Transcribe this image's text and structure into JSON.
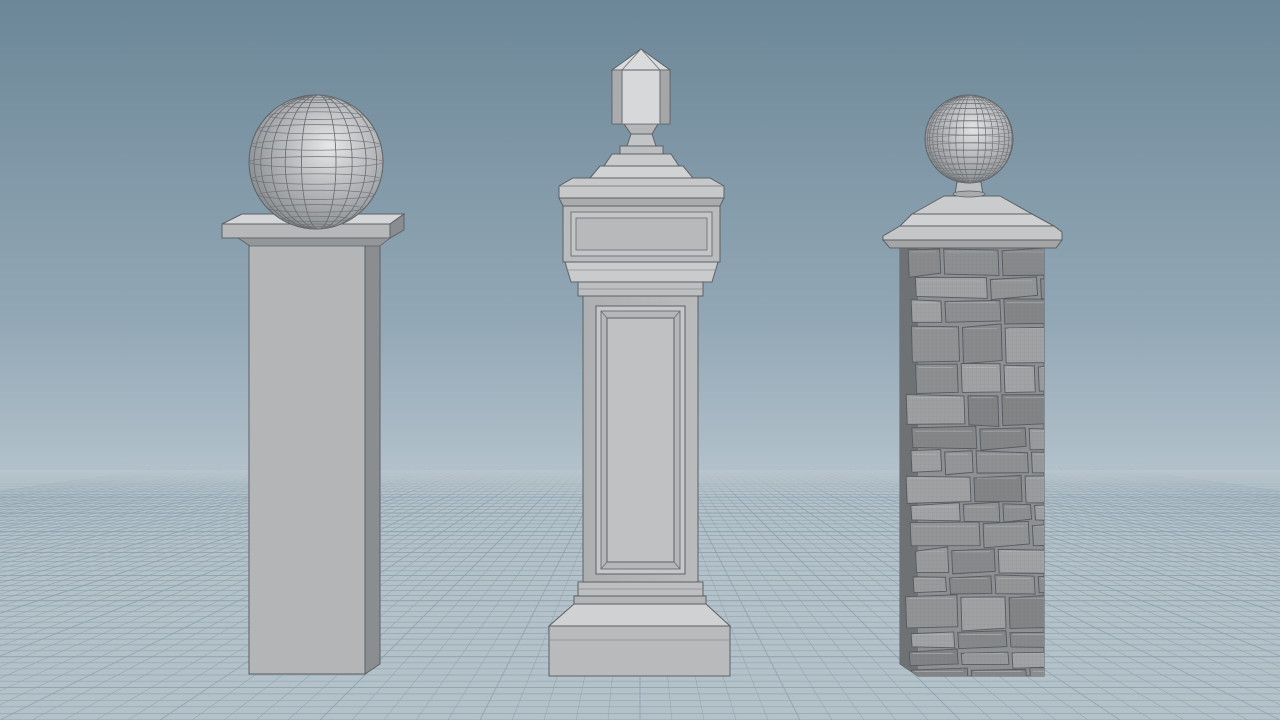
{
  "scene": {
    "colors": {
      "sky_top": "#6f8b9c",
      "sky_horizon": "#b9c7d0",
      "floor": "#adbcc5",
      "grid_line": "#8fa2ae",
      "grid_line_major": "#7f929e",
      "model_light": "#c2c4c6",
      "model_mid": "#a9abad",
      "model_dark": "#7d8083",
      "wire": "#8b8e91",
      "edge": "#5d6165"
    },
    "objects": [
      {
        "name": "plain-box-pillar-with-ball",
        "style": "smooth box shaft, flat slab cap, wireframe sphere"
      },
      {
        "name": "ornate-paneled-pillar-with-finial",
        "style": "raised-panel shaft, stepped cornice, faceted finial, stepped plinth"
      },
      {
        "name": "stone-pillar-with-ball",
        "style": "sculpted stacked-stone shaft, beveled cap, wireframe sphere"
      }
    ]
  }
}
